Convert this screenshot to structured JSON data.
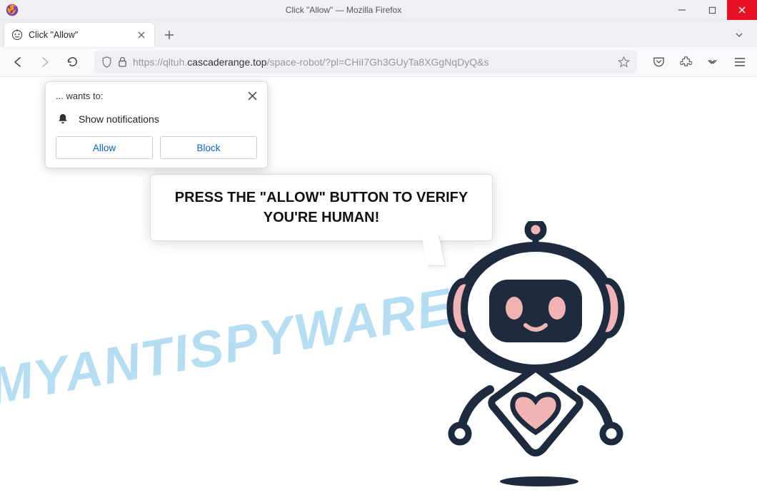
{
  "window": {
    "title": "Click \"Allow\" — Mozilla Firefox"
  },
  "tab": {
    "title": "Click \"Allow\""
  },
  "url": {
    "prefix": "https://qltuh.",
    "domain": "cascaderange.top",
    "path": "/space-robot/?pl=CHiI7Gh3GUyTa8XGgNqDyQ&s"
  },
  "permission": {
    "wants_to": "... wants to:",
    "label": "Show notifications",
    "allow": "Allow",
    "block": "Block"
  },
  "speech": {
    "text": "PRESS THE \"ALLOW\" BUTTON TO VERIFY YOU'RE HUMAN!"
  },
  "watermark": "MYANTISPYWARE.COM"
}
